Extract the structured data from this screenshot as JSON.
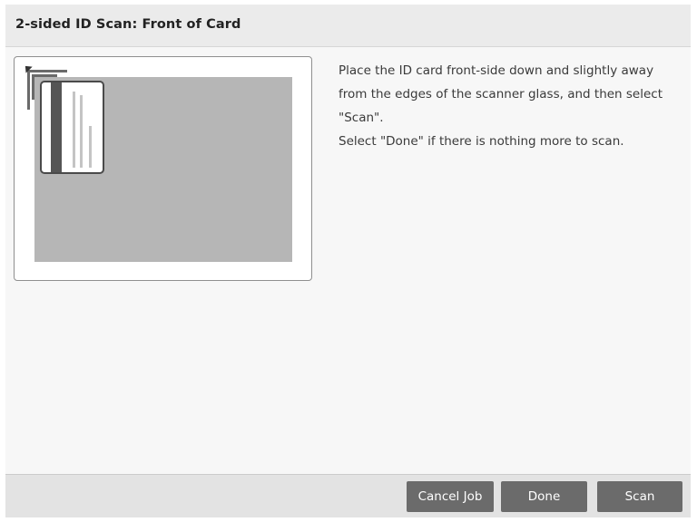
{
  "header": {
    "title": "2-sided ID Scan: Front of Card"
  },
  "diagram": {
    "icon": "id-card-on-scanner-glass-illustration"
  },
  "instructions": {
    "line1": "Place the ID card front-side down and slightly away from the edges of the scanner glass, and then select \"Scan\".",
    "line2": "Select \"Done\" if there is nothing more to scan."
  },
  "footer": {
    "cancel_label": "Cancel Job",
    "done_label": "Done",
    "scan_label": "Scan"
  },
  "colors": {
    "background": "#f7f7f7",
    "header_background": "#ebebeb",
    "button_background": "#6b6b6b",
    "button_text": "#ffffff",
    "scanner_glass": "#b6b6b6"
  }
}
